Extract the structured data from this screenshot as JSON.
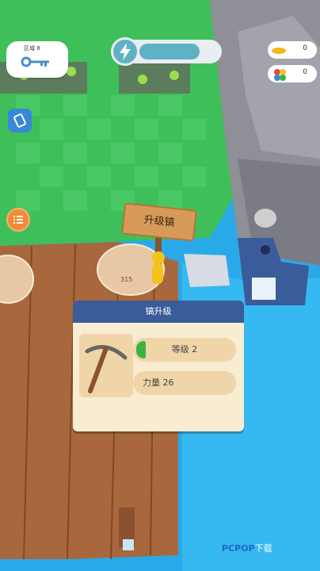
{
  "hud": {
    "area_label": "区域 8",
    "coins": "0",
    "gems": "0",
    "energy_fraction": 0.78
  },
  "scene": {
    "sign_text": "升级镐",
    "coin_tag": "315"
  },
  "upgrade_panel": {
    "title": "镐升级",
    "level_text": "等级 2",
    "level_fraction": 0.08,
    "power_text": "力量 26"
  },
  "watermark": {
    "brand": "PCPOP",
    "suffix": "下载"
  },
  "colors": {
    "panel_header": "#3b5c9a",
    "panel_body": "#f8ecd2",
    "stat_bg": "#efd5a8",
    "level_green": "#3db33d",
    "grass": "#3fbf5a",
    "water": "#2aa9e8",
    "energy": "#5fb2c4"
  },
  "icons": {
    "hud_key": "key-icon",
    "energy": "lightning-icon",
    "coins": "coin-icon",
    "gems": "gems-icon",
    "rotate": "rotate-camera-icon",
    "menu": "list-icon",
    "tool": "pickaxe-icon"
  }
}
